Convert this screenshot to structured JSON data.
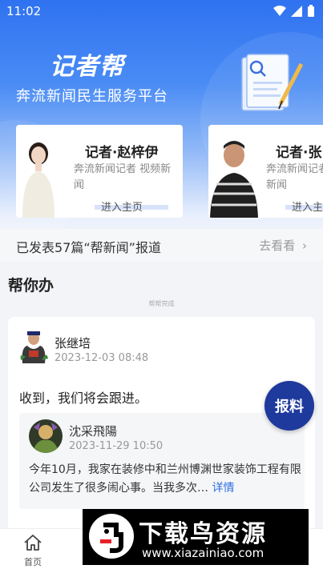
{
  "status_bar": {
    "time": "11:02"
  },
  "brand": {
    "title": "记者帮",
    "subtitle": "奔流新闻民生服务平台"
  },
  "reporters": [
    {
      "name": "记者·赵梓伊",
      "desc": "奔流新闻记者 视频新闻",
      "enter": "进入主页"
    },
    {
      "name": "记者·张",
      "desc": "奔流新闻记者 新闻",
      "enter": "进入主"
    }
  ],
  "published": {
    "text": "已发表57篇“帮新闻”报道",
    "go": "去看看"
  },
  "section": {
    "title": "帮你办",
    "subtitle": "帮帮完成"
  },
  "post": {
    "author": "张继培",
    "time": "2023-12-03 08:48",
    "reply": "收到，我们将会跟进。",
    "quote": {
      "author": "沈采飛陽",
      "time": "2023-11-29 10:50",
      "text": "今年10月，我家在装修中和兰州博渊世家装饰工程有限公司发生了很多闹心事。当我多次…",
      "detail": "详情"
    }
  },
  "report_button": "报料",
  "nav": {
    "home": "首页"
  },
  "watermark": {
    "text": "下载鸟资源",
    "url": "www.xiazainiao.com"
  },
  "colors": {
    "primary": "#2f72f0",
    "report": "#1e3a9c",
    "link": "#2f6fe0"
  }
}
